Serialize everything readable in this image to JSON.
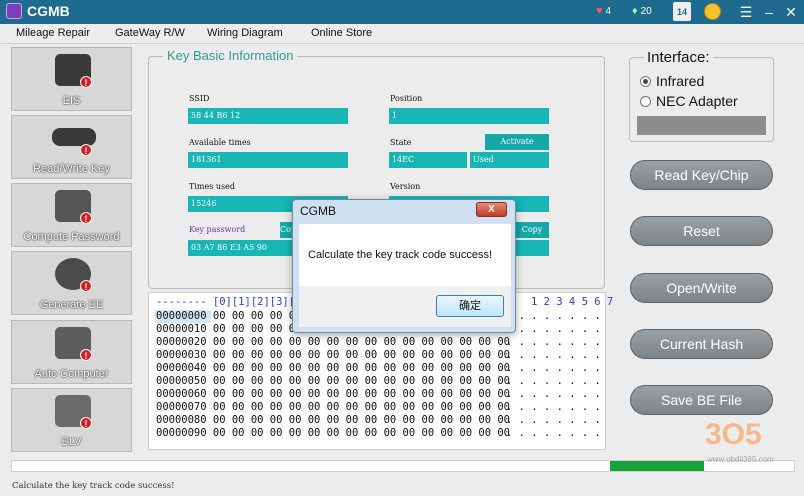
{
  "window": {
    "title": "CGMB"
  },
  "titlebar_stats": [
    {
      "icon": "heart-icon",
      "value": "4"
    },
    {
      "icon": "diamond-icon",
      "value": "20"
    }
  ],
  "calendar": {
    "day": "14"
  },
  "menu": [
    "Mileage Repair",
    "GateWay R/W",
    "Wiring Diagram",
    "Online Store"
  ],
  "nav": [
    {
      "label": "EIS",
      "icon": "eis-module-icon"
    },
    {
      "label": "Read/Write Key",
      "icon": "car-key-icon"
    },
    {
      "label": "Compute Password",
      "icon": "computer-icon"
    },
    {
      "label": "Generate EE",
      "icon": "chip-programmer-icon"
    },
    {
      "label": "Auto Computer",
      "icon": "ecu-icon"
    },
    {
      "label": "ELV",
      "icon": "steering-lock-icon"
    }
  ],
  "nav_badge": "!",
  "key_info": {
    "title": "Key Basic Information",
    "ssid_label": "SSID",
    "ssid": "58 44 B6 12",
    "position_label": "Position",
    "position": "1",
    "available_label": "Available times",
    "available": "181361",
    "state_label": "State",
    "activate_label": "Activate",
    "state": "14EC",
    "state_status": "Used",
    "used_label": "Times used",
    "used": "15246",
    "version_label": "Version",
    "version": "",
    "password_label": "Key password",
    "copy_label": "Copy",
    "password": "03 A7 86 E3 A5 90"
  },
  "hex": {
    "header": "-------- [0][1][2][3][4",
    "header_right": "1 2 3 4 5 6 7",
    "rows": [
      "00000000 00 00 00 00 00",
      "00000010 00 00 00 00 00",
      "00000020 00 00 00 00 00 00 00 00 00 00 00 00 00 00 00 00",
      "00000030 00 00 00 00 00 00 00 00 00 00 00 00 00 00 00 00",
      "00000040 00 00 00 00 00 00 00 00 00 00 00 00 00 00 00 00",
      "00000050 00 00 00 00 00 00 00 00 00 00 00 00 00 00 00 00",
      "00000060 00 00 00 00 00 00 00 00 00 00 00 00 00 00 00 00",
      "00000070 00 00 00 00 00 00 00 00 00 00 00 00 00 00 00 00",
      "00000080 00 00 00 00 00 00 00 00 00 00 00 00 00 00 00 00",
      "00000090 00 00 00 00 00 00 00 00 00 00 00 00 00 00 00 00"
    ],
    "ascii": [
      ". . . . . . . .",
      ". . . . . . . .",
      ". . . . . . . .",
      ". . . . . . . .",
      ". . . . . . . .",
      ". . . . . . . .",
      ". . . . . . . .",
      ". . . . . . . .",
      ". . . . . . . .",
      ". . . . . . . ."
    ]
  },
  "interface": {
    "title": "Interface:",
    "options": [
      "Infrared",
      "NEC Adapter"
    ],
    "selected": "Infrared"
  },
  "actions": [
    "Read Key/Chip",
    "Reset",
    "Open/Write",
    "Current Hash",
    "Save BE File"
  ],
  "progress": {
    "fraction": 0.12
  },
  "status": "Calculate the key track code success!",
  "dialog": {
    "title": "CGMB",
    "close": "X",
    "message": "Calculate the key track code success!",
    "ok": "确定"
  },
  "watermark": {
    "text": "3O5",
    "url": "www.obdii365.com"
  }
}
